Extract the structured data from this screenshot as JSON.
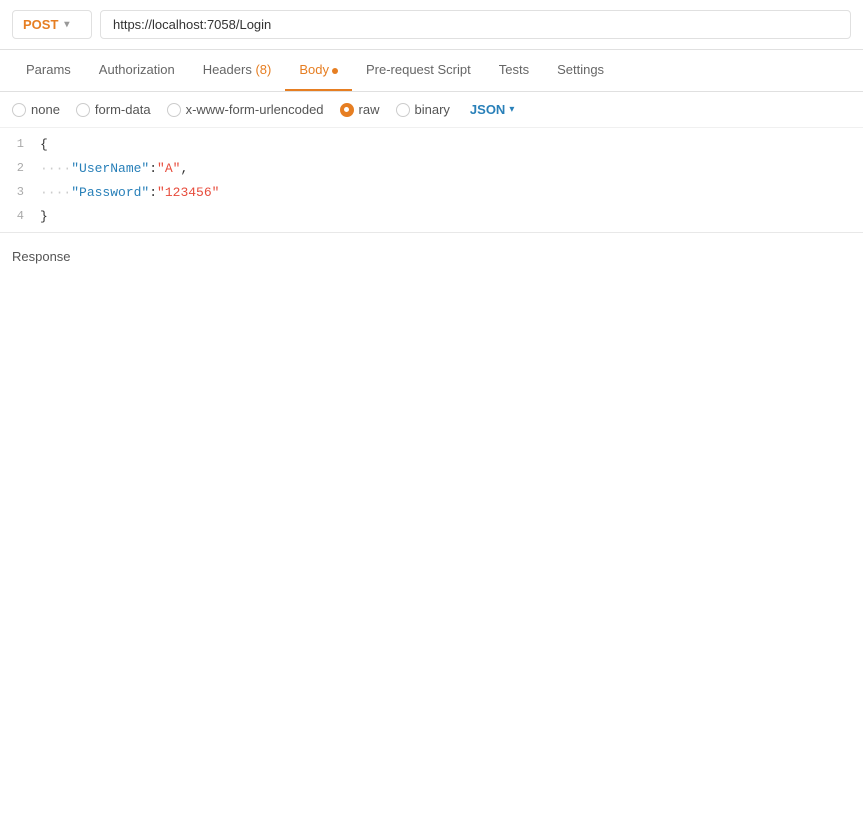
{
  "urlBar": {
    "method": "POST",
    "url": "https://localhost:7058/Login"
  },
  "tabs": [
    {
      "id": "params",
      "label": "Params",
      "active": false,
      "badge": null,
      "dot": false
    },
    {
      "id": "authorization",
      "label": "Authorization",
      "active": false,
      "badge": null,
      "dot": false
    },
    {
      "id": "headers",
      "label": "Headers",
      "active": false,
      "badge": "(8)",
      "dot": false
    },
    {
      "id": "body",
      "label": "Body",
      "active": true,
      "badge": null,
      "dot": true
    },
    {
      "id": "pre-request",
      "label": "Pre-request Script",
      "active": false,
      "badge": null,
      "dot": false
    },
    {
      "id": "tests",
      "label": "Tests",
      "active": false,
      "badge": null,
      "dot": false
    },
    {
      "id": "settings",
      "label": "Settings",
      "active": false,
      "badge": null,
      "dot": false
    }
  ],
  "bodyOptions": [
    {
      "id": "none",
      "label": "none",
      "checked": false
    },
    {
      "id": "form-data",
      "label": "form-data",
      "checked": false
    },
    {
      "id": "x-www-form-urlencoded",
      "label": "x-www-form-urlencoded",
      "checked": false
    },
    {
      "id": "raw",
      "label": "raw",
      "checked": true
    },
    {
      "id": "binary",
      "label": "binary",
      "checked": false
    }
  ],
  "jsonSelect": "JSON",
  "codeLines": [
    {
      "number": "1",
      "content": "{"
    },
    {
      "number": "2",
      "content": "    \"UserName\":\"A\","
    },
    {
      "number": "3",
      "content": "    \"Password\":\"123456\""
    },
    {
      "number": "4",
      "content": "}"
    }
  ],
  "response": {
    "label": "Response"
  }
}
